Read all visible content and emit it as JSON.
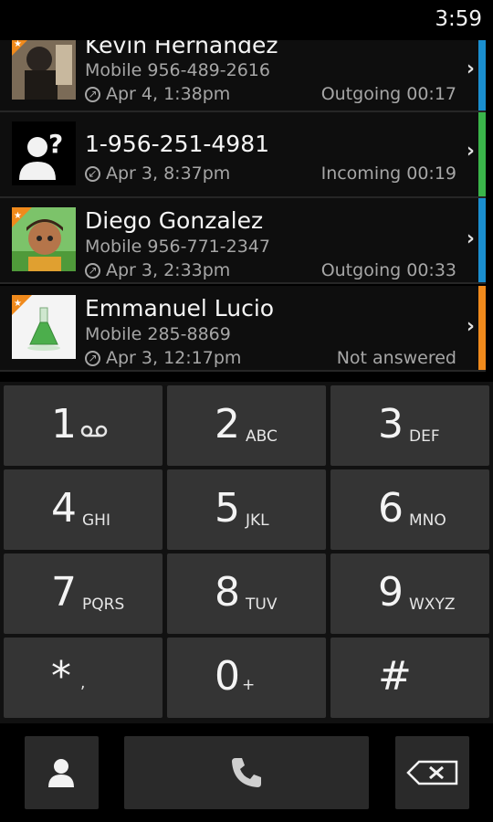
{
  "status_bar": {
    "time": "3:59"
  },
  "call_log": [
    {
      "name": "Kevin Hernandez",
      "number": "Mobile 956-489-2616",
      "when": "Apr 4, 1:38pm",
      "direction": "outgoing",
      "status": "Outgoing 00:17",
      "accent": "#1a8fd0"
    },
    {
      "name": "1-956-251-4981",
      "number": "",
      "when": "Apr 3, 8:37pm",
      "direction": "incoming",
      "status": "Incoming 00:19",
      "accent": "#3ab54a"
    },
    {
      "name": "Diego Gonzalez",
      "number": "Mobile 956-771-2347",
      "when": "Apr 3, 2:33pm",
      "direction": "outgoing",
      "status": "Outgoing 00:33",
      "accent": "#1a8fd0"
    },
    {
      "name": "Emmanuel Lucio",
      "number": "Mobile 285-8869",
      "when": "Apr 3, 12:17pm",
      "direction": "outgoing",
      "status": "Not answered",
      "accent": "#f08a1c"
    }
  ],
  "icons": {
    "chevron": "chevron-right-icon",
    "outgoing": "outgoing-call-icon",
    "incoming": "incoming-call-icon",
    "voicemail": "voicemail-icon",
    "contacts": "contacts-icon",
    "call": "phone-call-icon",
    "backspace": "backspace-icon"
  },
  "keypad": [
    {
      "digit": "1",
      "letters": ""
    },
    {
      "digit": "2",
      "letters": "ABC"
    },
    {
      "digit": "3",
      "letters": "DEF"
    },
    {
      "digit": "4",
      "letters": "GHI"
    },
    {
      "digit": "5",
      "letters": "JKL"
    },
    {
      "digit": "6",
      "letters": "MNO"
    },
    {
      "digit": "7",
      "letters": "PQRS"
    },
    {
      "digit": "8",
      "letters": "TUV"
    },
    {
      "digit": "9",
      "letters": "WXYZ"
    },
    {
      "digit": "*",
      "letters": ","
    },
    {
      "digit": "0",
      "letters": "+"
    },
    {
      "digit": "#",
      "letters": ""
    }
  ]
}
